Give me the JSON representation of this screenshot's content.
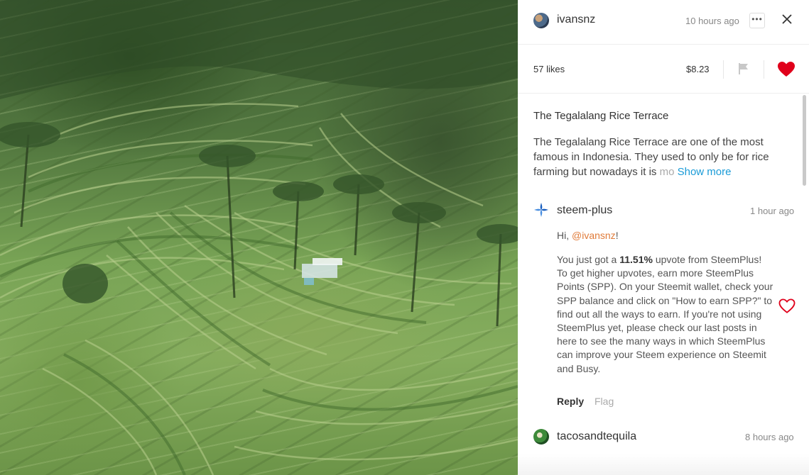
{
  "photo": {
    "alt": "Tegalalang rice terraces"
  },
  "post": {
    "author": "ivansnz",
    "time": "10 hours ago",
    "more_label": "•••",
    "likes": "57 likes",
    "payout": "$8.23",
    "liked": true,
    "title": "The Tegalalang Rice Terrace",
    "body_visible": "The Tegalalang Rice Terrace are one of the most famous in Indonesia. They used to only be for rice farming but nowadays it is",
    "body_faded": "mo",
    "show_more": "Show more"
  },
  "comments": [
    {
      "author": "steem-plus",
      "time": "1 hour ago",
      "greeting_prefix": "Hi, ",
      "mention": "@ivansnz",
      "greeting_suffix": "!",
      "body_before": "You just got a ",
      "body_bold": "11.51%",
      "body_after": " upvote from SteemPlus! To get higher upvotes, earn more SteemPlus Points (SPP). On your Steemit wallet, check your SPP balance and click on \"How to earn SPP?\" to find out all the ways to earn. If you're not using SteemPlus yet, please check our last posts in here to see the many ways in which SteemPlus can improve your Steem experience on Steemit and Busy.",
      "reply_label": "Reply",
      "flag_label": "Flag"
    },
    {
      "author": "tacosandtequila",
      "time": "8 hours ago"
    }
  ],
  "colors": {
    "heart_red": "#e0001b",
    "link_blue": "#1a9bd7",
    "mention_orange": "#e07b39",
    "steemplus_blue": "#1a5fbf"
  },
  "icons": [
    "more-icon",
    "close-icon",
    "flag-icon",
    "heart-icon",
    "steemplus-logo-icon"
  ]
}
